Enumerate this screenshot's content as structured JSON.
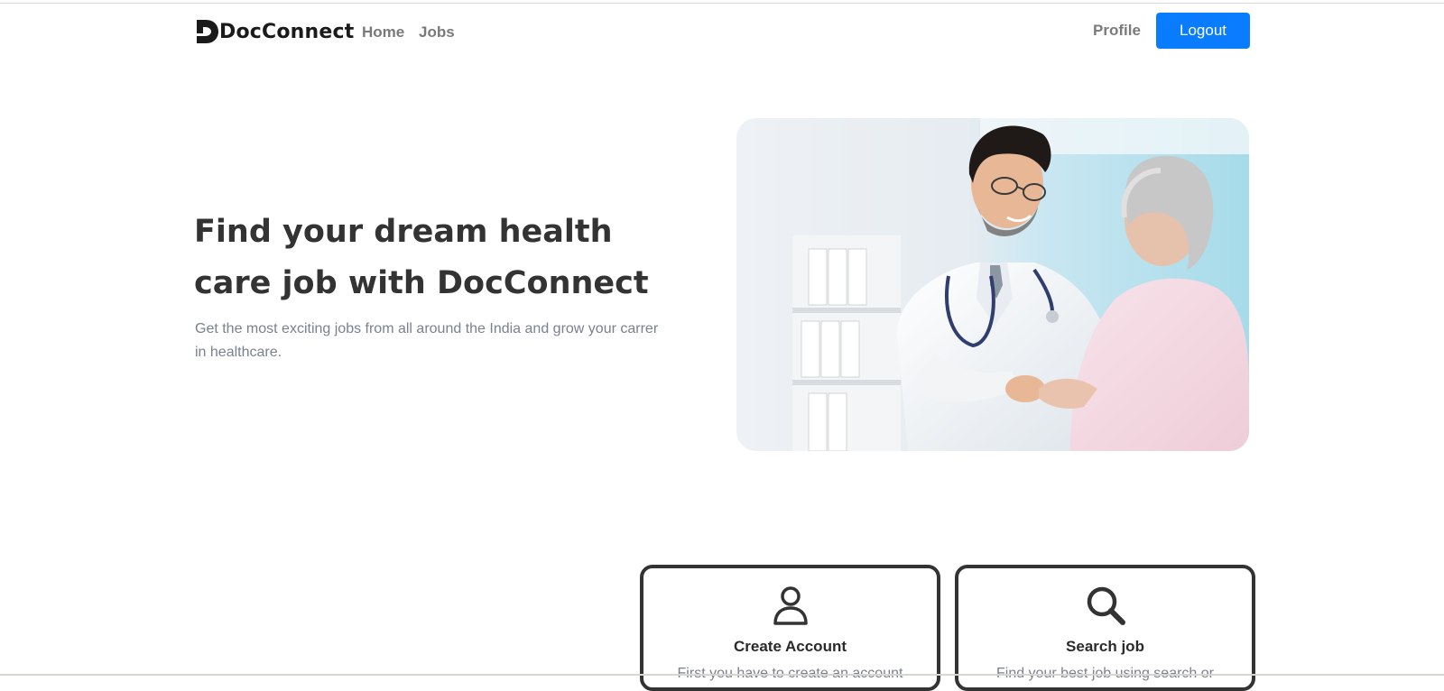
{
  "navbar": {
    "brand": "DocConnect",
    "links": [
      {
        "label": "Home"
      },
      {
        "label": "Jobs"
      }
    ],
    "profile_label": "Profile",
    "logout_label": "Logout",
    "accent_color": "#0a7cff"
  },
  "hero": {
    "title": "Find your dream health care job with DocConnect",
    "subtitle": "Get the most exciting jobs from all around the India and grow your carrer in healthcare.",
    "image_icon": "doctor-patient-photo"
  },
  "steps": [
    {
      "icon": "user-icon",
      "title": "Create Account",
      "text": "First you have to create an account"
    },
    {
      "icon": "search-icon",
      "title": "Search job",
      "text": "Find your best job using search or"
    }
  ]
}
